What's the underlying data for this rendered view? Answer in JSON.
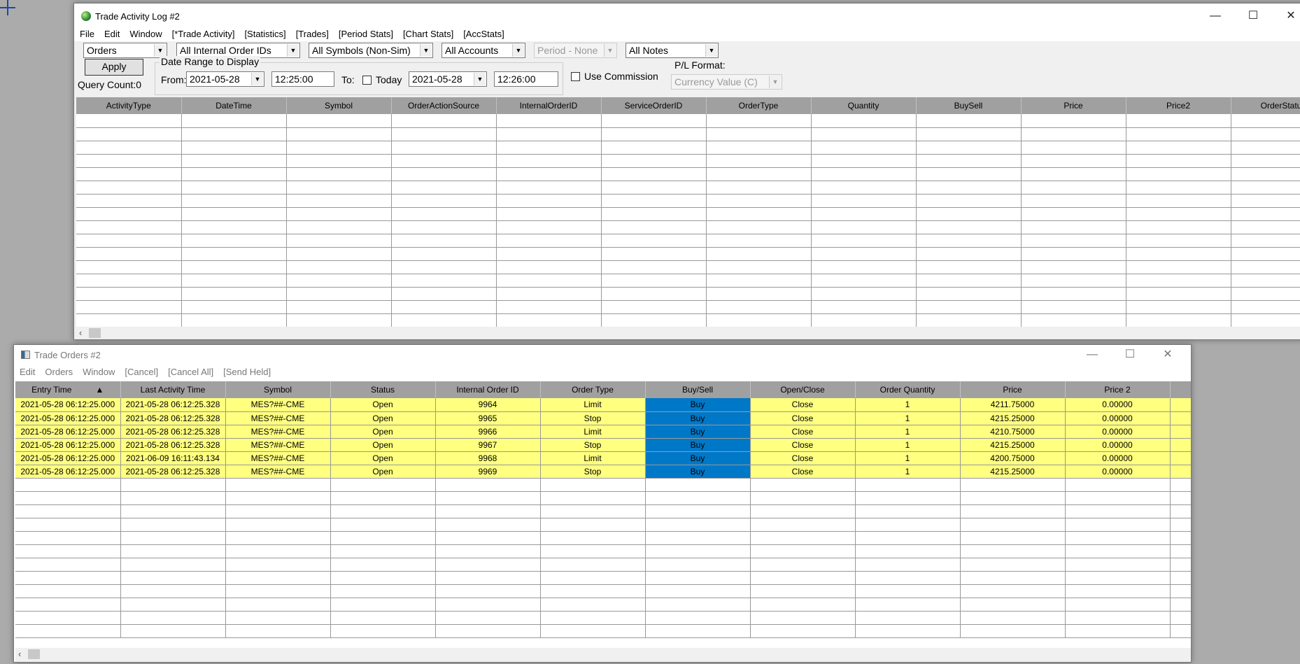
{
  "activity_log": {
    "title": "Trade Activity Log #2",
    "menu": [
      "File",
      "Edit",
      "Window",
      "[*Trade Activity]",
      "[Statistics]",
      "[Trades]",
      "[Period Stats]",
      "[Chart Stats]",
      "[AccStats]"
    ],
    "filters": {
      "type": "Orders",
      "order_ids": "All Internal Order IDs",
      "symbols": "All Symbols (Non-Sim)",
      "accounts": "All Accounts",
      "period": "Period - None",
      "notes": "All Notes"
    },
    "apply_label": "Apply",
    "query_count": "Query Count:0",
    "date_range_label": "Date Range to Display",
    "from_label": "From:",
    "from_date": "2021-05-28",
    "from_time": "12:25:00",
    "to_label": "To:",
    "today_label": "Today",
    "to_date": "2021-05-28",
    "to_time": "12:26:00",
    "use_commission_label": "Use Commission",
    "pl_format_label": "P/L Format:",
    "pl_format_value": "Currency Value (C)",
    "columns": [
      "ActivityType",
      "DateTime",
      "Symbol",
      "OrderActionSource",
      "InternalOrderID",
      "ServiceOrderID",
      "OrderType",
      "Quantity",
      "BuySell",
      "Price",
      "Price2",
      "OrderStatus"
    ]
  },
  "trade_orders": {
    "title": "Trade Orders #2",
    "menu": [
      "Edit",
      "Orders",
      "Window",
      "[Cancel]",
      "[Cancel All]",
      "[Send Held]"
    ],
    "sort_indicator": "▲",
    "columns": [
      "Entry Time",
      "Last Activity Time",
      "Symbol",
      "Status",
      "Internal Order ID",
      "Order Type",
      "Buy/Sell",
      "Open/Close",
      "Order Quantity",
      "Price",
      "Price 2",
      ""
    ],
    "rows": [
      [
        "2021-05-28  06:12:25.000",
        "2021-05-28  06:12:25.328",
        "MES?##-CME",
        "Open",
        "9964",
        "Limit",
        "Buy",
        "Close",
        "1",
        "4211.75000",
        "0.00000",
        ""
      ],
      [
        "2021-05-28  06:12:25.000",
        "2021-05-28  06:12:25.328",
        "MES?##-CME",
        "Open",
        "9965",
        "Stop",
        "Buy",
        "Close",
        "1",
        "4215.25000",
        "0.00000",
        ""
      ],
      [
        "2021-05-28  06:12:25.000",
        "2021-05-28  06:12:25.328",
        "MES?##-CME",
        "Open",
        "9966",
        "Limit",
        "Buy",
        "Close",
        "1",
        "4210.75000",
        "0.00000",
        ""
      ],
      [
        "2021-05-28  06:12:25.000",
        "2021-05-28  06:12:25.328",
        "MES?##-CME",
        "Open",
        "9967",
        "Stop",
        "Buy",
        "Close",
        "1",
        "4215.25000",
        "0.00000",
        ""
      ],
      [
        "2021-05-28  06:12:25.000",
        "2021-06-09  16:11:43.134",
        "MES?##-CME",
        "Open",
        "9968",
        "Limit",
        "Buy",
        "Close",
        "1",
        "4200.75000",
        "0.00000",
        ""
      ],
      [
        "2021-05-28  06:12:25.000",
        "2021-05-28  06:12:25.328",
        "MES?##-CME",
        "Open",
        "9969",
        "Stop",
        "Buy",
        "Close",
        "1",
        "4215.25000",
        "0.00000",
        ""
      ]
    ]
  },
  "colors": {
    "desktop": "#ababab",
    "row_highlight": "#ffff80",
    "buy_cell": "#0078c8",
    "header": "#a0a0a0"
  }
}
